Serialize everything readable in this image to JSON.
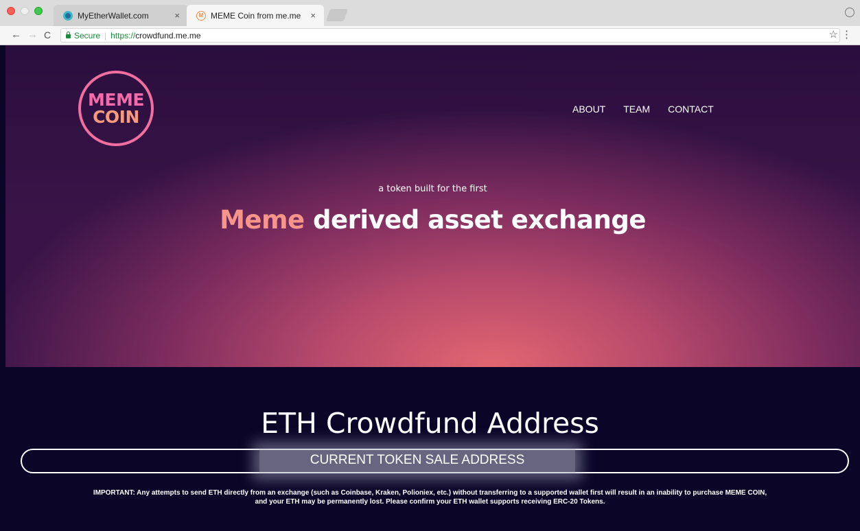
{
  "browser": {
    "tabs": [
      {
        "title": "MyEtherWallet.com",
        "close": "×"
      },
      {
        "title": "MEME Coin from me.me",
        "close": "×",
        "favicon_letter": "M"
      }
    ],
    "secure_label": "Secure",
    "url_scheme": "https://",
    "url_host": "crowdfund.me.me",
    "url_separator": "|",
    "nav_back": "←",
    "nav_forward": "→",
    "nav_reload": "C",
    "bookmark_star": "☆",
    "menu": "⋮"
  },
  "header": {
    "logo_line1": "MEME",
    "logo_line2": "COIN",
    "nav": [
      "ABOUT",
      "TEAM",
      "CONTACT"
    ]
  },
  "hero": {
    "tagline": "a token built for the first",
    "headline_accent": "Meme",
    "headline_rest": " derived asset exchange"
  },
  "crowdfund": {
    "title": "ETH Crowdfund Address",
    "address_label": "CURRENT TOKEN SALE ADDRESS",
    "notice_line1": "IMPORTANT: Any attempts to send ETH directly from an exchange (such as Coinbase, Kraken, Polioniex, etc.) without transferring to a supported wallet first will result in an inability to purchase MEME COIN,",
    "notice_line2": "and your ETH may be permanently lost. Please confirm your ETH wallet supports receiving ERC-20 Tokens."
  },
  "colors": {
    "accent_pink": "#f56aaa",
    "accent_peach": "#f7958a",
    "secure_green": "#1a8d3c",
    "page_bg": "#0b0528"
  }
}
